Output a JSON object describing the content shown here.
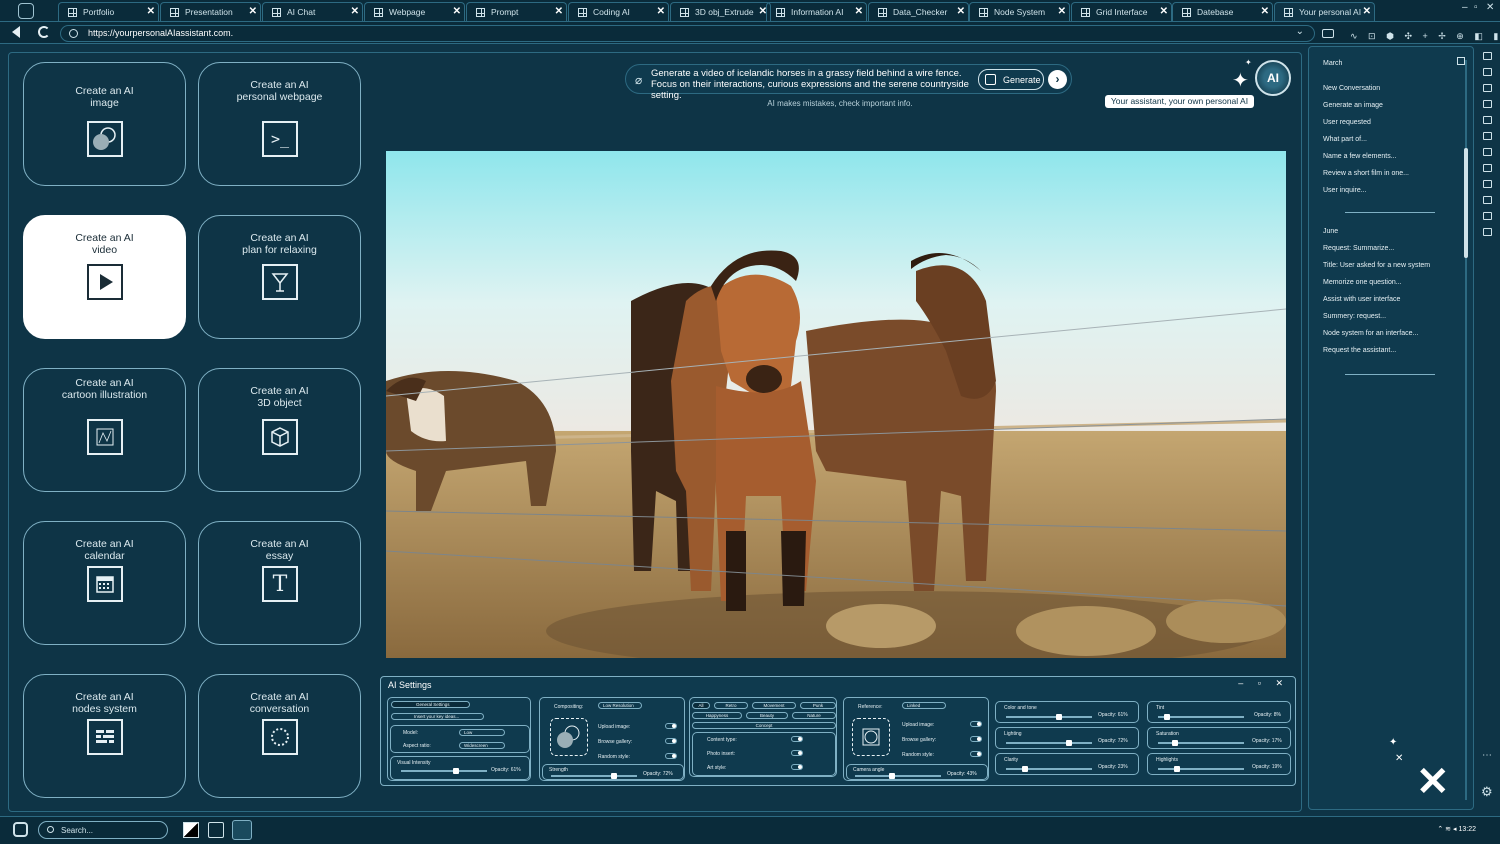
{
  "tabs": [
    {
      "label": "Portfolio"
    },
    {
      "label": "Presentation"
    },
    {
      "label": "AI Chat"
    },
    {
      "label": "Webpage"
    },
    {
      "label": "Prompt"
    },
    {
      "label": "Coding AI"
    },
    {
      "label": "3D obj_Extrude"
    },
    {
      "label": "Information AI"
    },
    {
      "label": "Data_Checker"
    },
    {
      "label": "Node System"
    },
    {
      "label": "Grid Interface"
    },
    {
      "label": "Datebase"
    },
    {
      "label": "Your personal AI"
    }
  ],
  "address": {
    "url": "https://yourpersonalAIassistant.com."
  },
  "cards": [
    {
      "label": "Create an AI\nimage",
      "icon": "image-generate-icon"
    },
    {
      "label": "Create an AI\npersonal webpage",
      "icon": "terminal-icon"
    },
    {
      "label": "Create an AI\nvideo",
      "icon": "play-icon"
    },
    {
      "label": "Create an AI\nplan for relaxing",
      "icon": "cocktail-icon"
    },
    {
      "label": "Create an AI\ncartoon illustration",
      "icon": "illustration-icon"
    },
    {
      "label": "Create an AI\n3D object",
      "icon": "cube-icon"
    },
    {
      "label": "Create an AI\ncalendar",
      "icon": "calendar-icon"
    },
    {
      "label": "Create an AI\nessay",
      "icon": "text-icon"
    },
    {
      "label": "Create an AI\nnodes system",
      "icon": "nodes-icon"
    },
    {
      "label": "Create an AI\nconversation",
      "icon": "conversation-icon"
    }
  ],
  "prompt": {
    "text": "Generate a video of icelandic horses in a grassy field behind a wire fence. Focus on their interactions, curious expressions and the serene countryside setting.",
    "generate_label": "Generate",
    "disclaimer": "AI makes mistakes, check important info."
  },
  "assistant": {
    "avatar_label": "AI",
    "tagline": "Your assistant, your own personal AI"
  },
  "settings": {
    "title": "AI Settings",
    "general": {
      "header": "General Settings",
      "search_placeholder": "Insert your key ideas...",
      "model_label": "Model:",
      "model_value": "Low",
      "aspect_label": "Aspect ratio:",
      "aspect_value": "Widescreen",
      "intensity_label": "Visual Intensity",
      "intensity_opacity": "Opacity: 61%"
    },
    "compositing": {
      "label": "Compositing:",
      "value": "Low Resolution",
      "upload": "Upload image:",
      "browse": "Browse gallery:",
      "random": "Random style:",
      "strength_label": "Strength",
      "strength_opacity": "Opacity: 72%"
    },
    "concept": {
      "tags_row1": [
        "All",
        "Retro",
        "Movement",
        "Punk"
      ],
      "tags_row2": [
        "Happyness",
        "Beauty",
        "Nature"
      ],
      "concept_label": "Concept",
      "content_type": "Content type:",
      "photo_insert": "Photo insert:",
      "art_style": "Art style:"
    },
    "reference": {
      "label": "Reference:",
      "value": "Linked",
      "upload": "Upload image:",
      "browse": "Browse gallery:",
      "random": "Random style:",
      "camera_label": "Camera angle",
      "camera_opacity": "Opacity: 43%"
    },
    "color": [
      {
        "label": "Color and tone",
        "opacity": "Opacity: 61%"
      },
      {
        "label": "Lighting",
        "opacity": "Opacity: 72%"
      },
      {
        "label": "Clarity",
        "opacity": "Opacity: 23%"
      }
    ],
    "tint": [
      {
        "label": "Tint",
        "opacity": "Opacity: 8%"
      },
      {
        "label": "Saturation",
        "opacity": "Opacity: 17%"
      },
      {
        "label": "Highlights",
        "opacity": "Opacity: 19%"
      }
    ]
  },
  "sidebar": {
    "month1": "March",
    "items1": [
      "New Conversation",
      "Generate an image",
      "User requested",
      "What part of...",
      "Name a few elements...",
      "Review a short film in one...",
      "User inquire..."
    ],
    "month2": "June",
    "items2": [
      "Request: Summarize...",
      "Title: User asked for a new system",
      "Memorize one question...",
      "Assist with user interface",
      "Summery: request...",
      "Node system for an interface...",
      "Request the assistant..."
    ]
  },
  "taskbar": {
    "search_placeholder": "Search...",
    "time": "13:22"
  }
}
